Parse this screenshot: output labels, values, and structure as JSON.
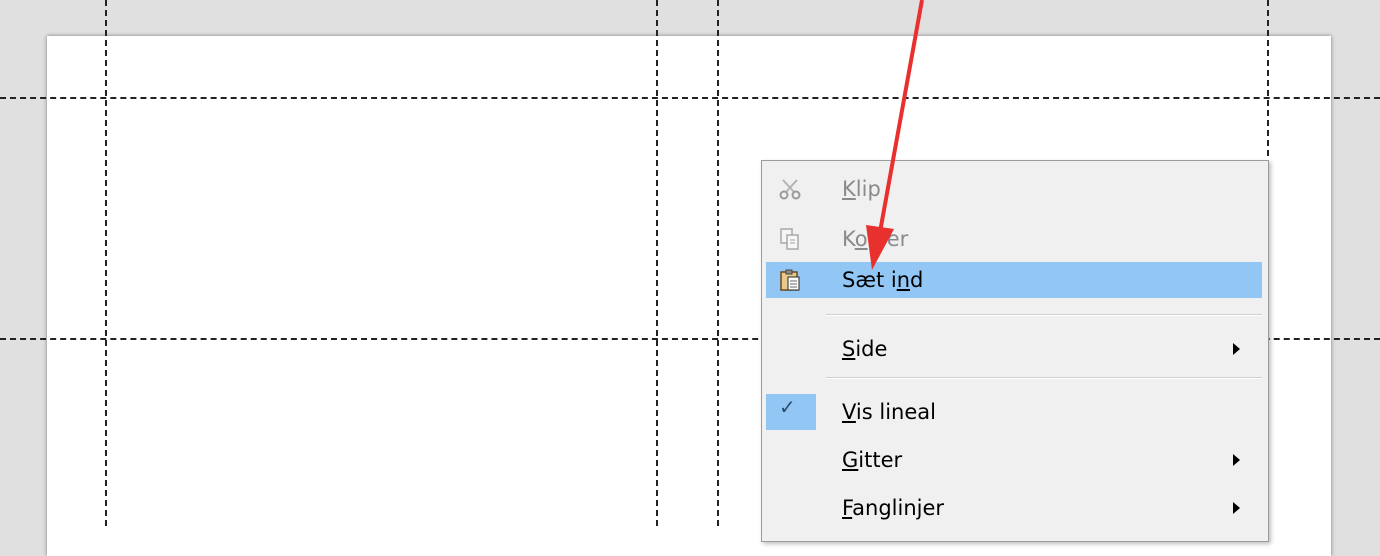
{
  "context_menu": {
    "items": [
      {
        "id": "cut",
        "pre": "",
        "accel": "K",
        "post": "lip",
        "enabled": false,
        "icon": "scissors-icon"
      },
      {
        "id": "copy",
        "pre": "K",
        "accel": "o",
        "post": "pier",
        "enabled": false,
        "icon": "copy-icon"
      },
      {
        "id": "paste",
        "pre": "Sæt i",
        "accel": "n",
        "post": "d",
        "enabled": true,
        "highlighted": true,
        "icon": "clipboard-icon"
      },
      {
        "id": "side",
        "pre": "",
        "accel": "S",
        "post": "ide",
        "enabled": true,
        "submenu": true
      },
      {
        "id": "show-ruler",
        "pre": "",
        "accel": "V",
        "post": "is lineal",
        "enabled": true,
        "checked": true
      },
      {
        "id": "grid",
        "pre": "",
        "accel": "G",
        "post": "itter",
        "enabled": true,
        "submenu": true
      },
      {
        "id": "snap-lines",
        "pre": "",
        "accel": "F",
        "post": "anglinjer",
        "enabled": true,
        "submenu": true
      }
    ]
  },
  "colors": {
    "background": "#e0e0e0",
    "page": "#ffffff",
    "menu_background": "#f0f0f0",
    "highlight": "#92c7f5",
    "disabled_text": "#8a8a8a",
    "annotation_arrow": "#e8312f"
  }
}
